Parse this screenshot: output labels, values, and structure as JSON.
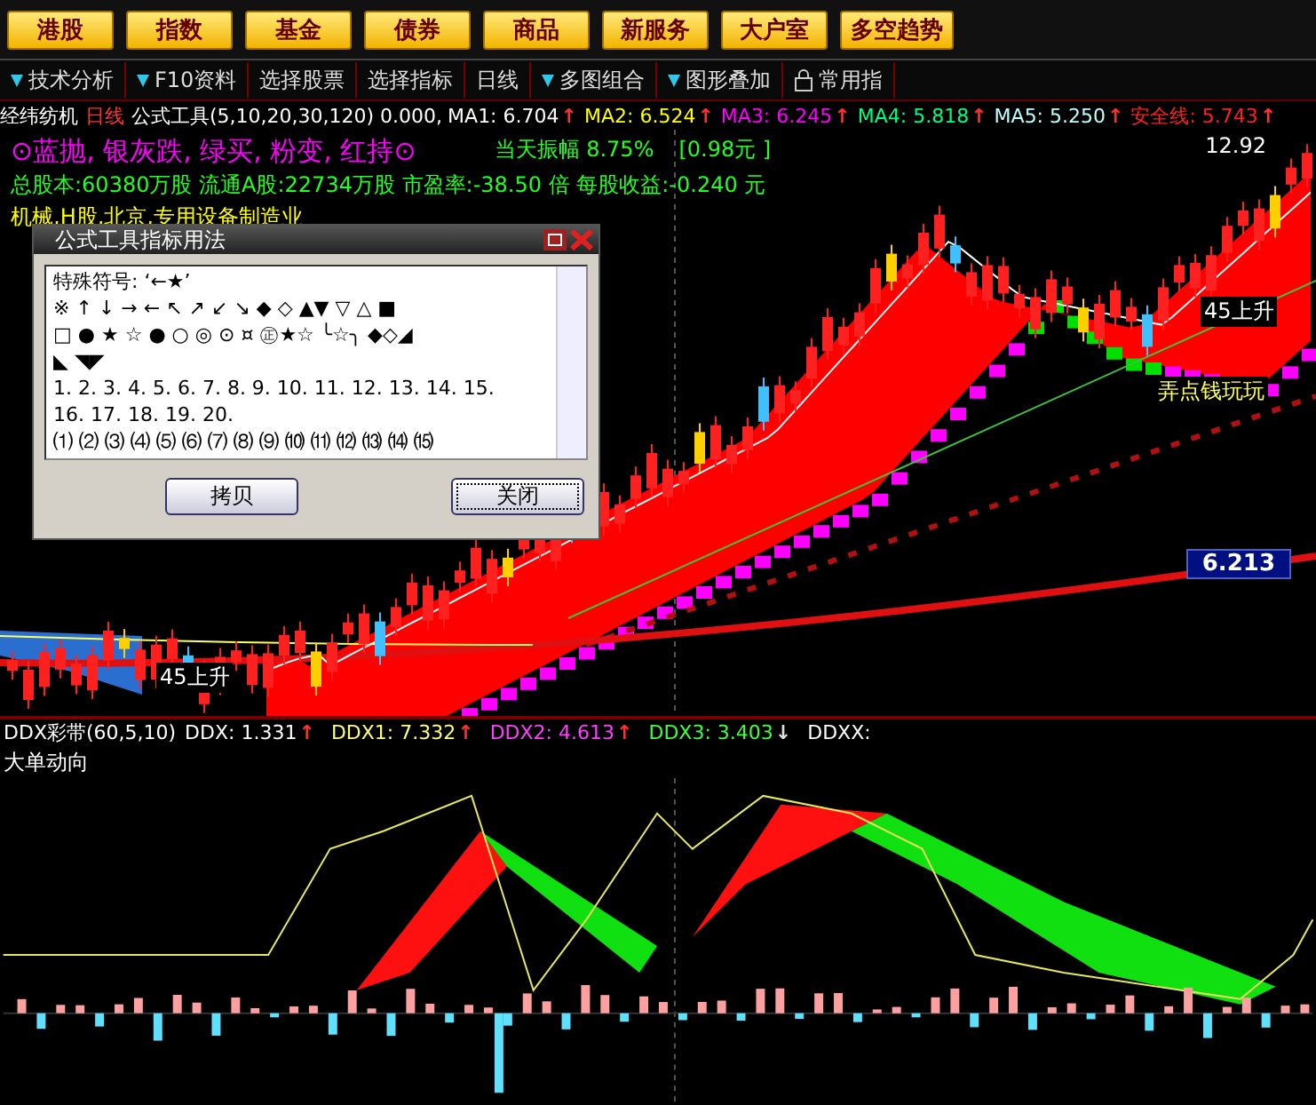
{
  "market_buttons": [
    "港股",
    "指数",
    "基金",
    "债券",
    "商品",
    "新服务",
    "大户室",
    "多空趋势"
  ],
  "toolbar": [
    {
      "label": "技术分析",
      "dropdown": true
    },
    {
      "label": "F10资料",
      "dropdown": true
    },
    {
      "label": "选择股票",
      "dropdown": false
    },
    {
      "label": "选择指标",
      "dropdown": false
    },
    {
      "label": "日线",
      "dropdown": false
    },
    {
      "label": "多图组合",
      "dropdown": true
    },
    {
      "label": "图形叠加",
      "dropdown": true
    },
    {
      "label": "常用指",
      "dropdown": false,
      "locked": true
    }
  ],
  "chart_header": {
    "stock": "经纬纺机",
    "period": "日线",
    "formula": "公式工具(5,10,20,30,120) 0.000,",
    "indicators": [
      {
        "label": "MA1: 6.704",
        "arrow": "↑",
        "color": "#ffffff"
      },
      {
        "label": "MA2: 6.524",
        "arrow": "↑",
        "color": "#ffff00"
      },
      {
        "label": "MA3: 6.245",
        "arrow": "↑",
        "color": "#ff00ff"
      },
      {
        "label": "MA4: 5.818",
        "arrow": "↑",
        "color": "#00ff80"
      },
      {
        "label": "MA5: 5.250",
        "arrow": "↑",
        "color": "#c0ffff"
      },
      {
        "label": "安全线: 5.743",
        "arrow": "↑",
        "color": "#ff2020"
      }
    ]
  },
  "info": {
    "legend": "⊙蓝抛, 银灰跌, 绿买, 粉变, 红持⊙",
    "amplitude": "当天振幅 8.75%",
    "amplitude_price": "[0.98元 ]",
    "stats": "总股本:60380万股 流通A股:22734万股 市盈率:-38.50 倍 每股收益:-0.240 元",
    "industry": "机械,H股,北京,专用设备制造业"
  },
  "chart_labels": {
    "high_price": "12.92",
    "last_price": "6.213",
    "annotations": [
      "45上升",
      "45上升",
      "弄点钱玩玩"
    ]
  },
  "dialog": {
    "title": "公式工具指标用法",
    "lines": [
      "特殊符号: ‘←★’",
      "※ ↑ ↓ → ← ↖ ↗ ↙ ↘ ◆ ◇ ▲▼ ▽ △ ■",
      "□ ● ★ ☆ ● ○ ◎ ⊙ ¤ ㊣★☆ ╰☆╮ ◆◇◢",
      "◣ ◥◤",
      "1. 2. 3. 4. 5. 6. 7. 8. 9. 10. 11. 12. 13. 14. 15.",
      "16. 17. 18. 19. 20.",
      "⑴ ⑵ ⑶ ⑷ ⑸ ⑹ ⑺ ⑻ ⑼ ⑽ ⑾ ⑿ ⒀ ⒁ ⒂"
    ],
    "buttons": [
      {
        "label": "拷贝",
        "focused": false
      },
      {
        "label": "关闭",
        "focused": true
      }
    ]
  },
  "ddx": {
    "title": "DDX彩带(60,5,10)",
    "values": [
      {
        "label": "DDX: 1.331",
        "arrow": "↑",
        "color": "#ffffff"
      },
      {
        "label": "DDX1: 7.332",
        "arrow": "↑",
        "color": "#ffff80"
      },
      {
        "label": "DDX2: 4.613",
        "arrow": "↑",
        "color": "#ff40ff"
      },
      {
        "label": "DDX3: 3.403",
        "arrow": "↓",
        "color": "#40ff40"
      },
      {
        "label": "DDXX:",
        "color": "#ffffff"
      }
    ],
    "subtitle": "大单动向"
  }
}
